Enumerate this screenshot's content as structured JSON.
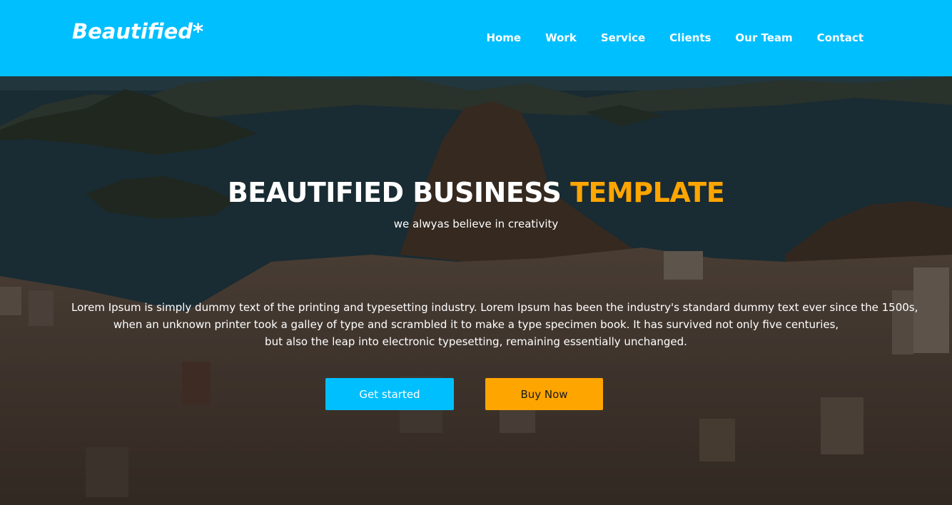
{
  "header": {
    "logo": "Beautified*",
    "nav": [
      "Home",
      "Work",
      "Service",
      "Clients",
      "Our Team",
      "Contact"
    ]
  },
  "hero": {
    "title_main": "BEAUTIFIED BUSINESS",
    "title_accent": "TEMPLATE",
    "tagline": "we alwyas believe in creativity",
    "description_lines": [
      "Lorem Ipsum is simply dummy text of the printing and typesetting industry. Lorem Ipsum has been the industry's standard dummy text ever since the 1500s,",
      "when an unknown printer took a galley of type and scrambled it to make a type specimen book. It has survived not only five centuries,",
      "but also the leap into electronic typesetting, remaining essentially unchanged."
    ],
    "buttons": {
      "get_started": "Get started",
      "buy_now": "Buy Now"
    }
  },
  "colors": {
    "brand": "#00bfff",
    "accent": "#ffa500"
  }
}
